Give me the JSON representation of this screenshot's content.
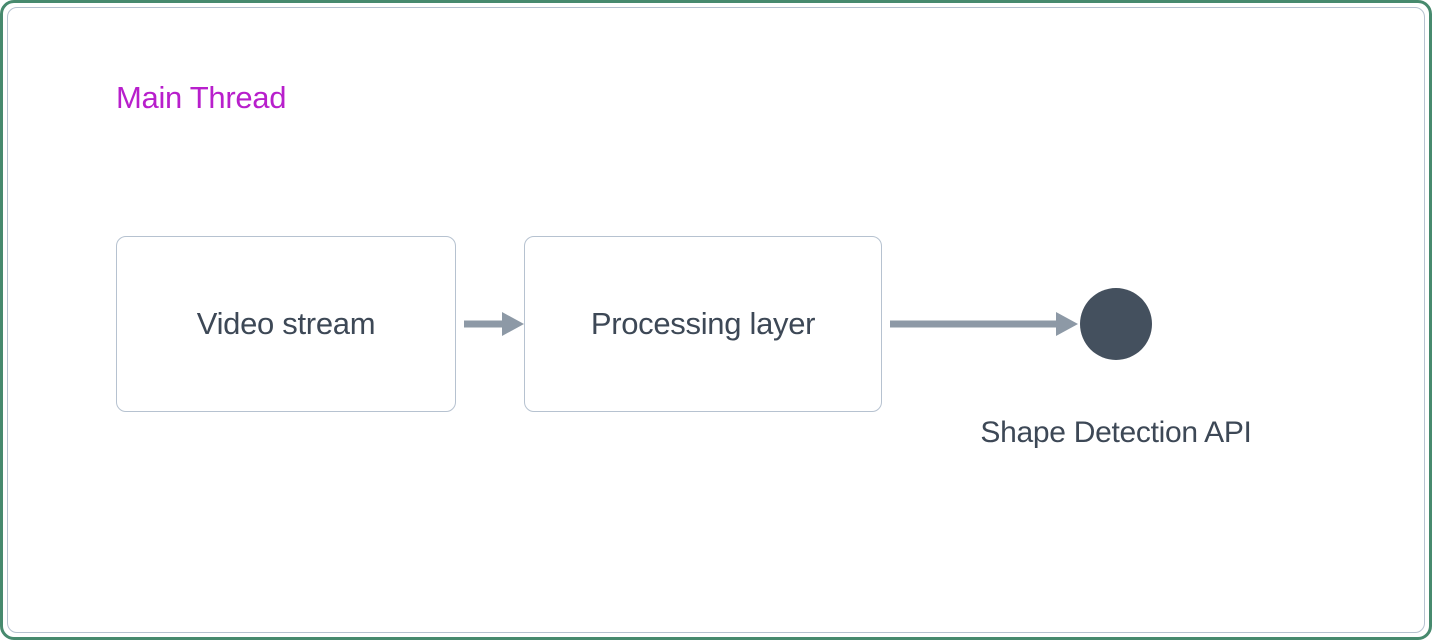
{
  "diagram": {
    "thread_title": "Main Thread",
    "nodes": {
      "video_stream": "Video stream",
      "processing_layer": "Processing layer",
      "shape_detection_api": "Shape Detection API"
    },
    "colors": {
      "outer_border": "#478a6e",
      "inner_border": "#b6c2d0",
      "title": "#b81fcc",
      "text": "#3d4856",
      "circle": "#44505e",
      "arrow": "#8d99a6"
    }
  }
}
